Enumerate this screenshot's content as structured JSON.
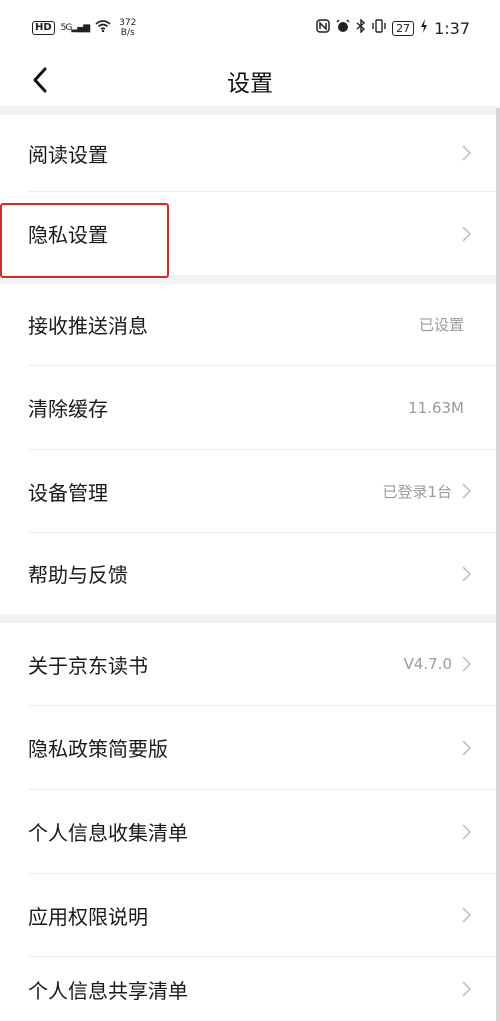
{
  "status_bar": {
    "hd_badge": "HD",
    "signal": "5G",
    "net_speed_value": "372",
    "net_speed_unit": "B/s",
    "battery": "27",
    "time": "1:37"
  },
  "header": {
    "title": "设置"
  },
  "rows": [
    {
      "label": "阅读设置",
      "value": ""
    },
    {
      "label": "隐私设置",
      "value": ""
    },
    {
      "label": "接收推送消息",
      "value": "已设置"
    },
    {
      "label": "清除缓存",
      "value": "11.63M"
    },
    {
      "label": "设备管理",
      "value": "已登录1台"
    },
    {
      "label": "帮助与反馈",
      "value": ""
    },
    {
      "label": "关于京东读书",
      "value": "V4.7.0"
    },
    {
      "label": "隐私政策简要版",
      "value": ""
    },
    {
      "label": "个人信息收集清单",
      "value": ""
    },
    {
      "label": "应用权限说明",
      "value": ""
    },
    {
      "label": "个人信息共享清单",
      "value": ""
    }
  ],
  "colors": {
    "highlight": "#d62a2a",
    "secondary_text": "#9b9b9b",
    "section_gap": "#f2f2f2"
  }
}
